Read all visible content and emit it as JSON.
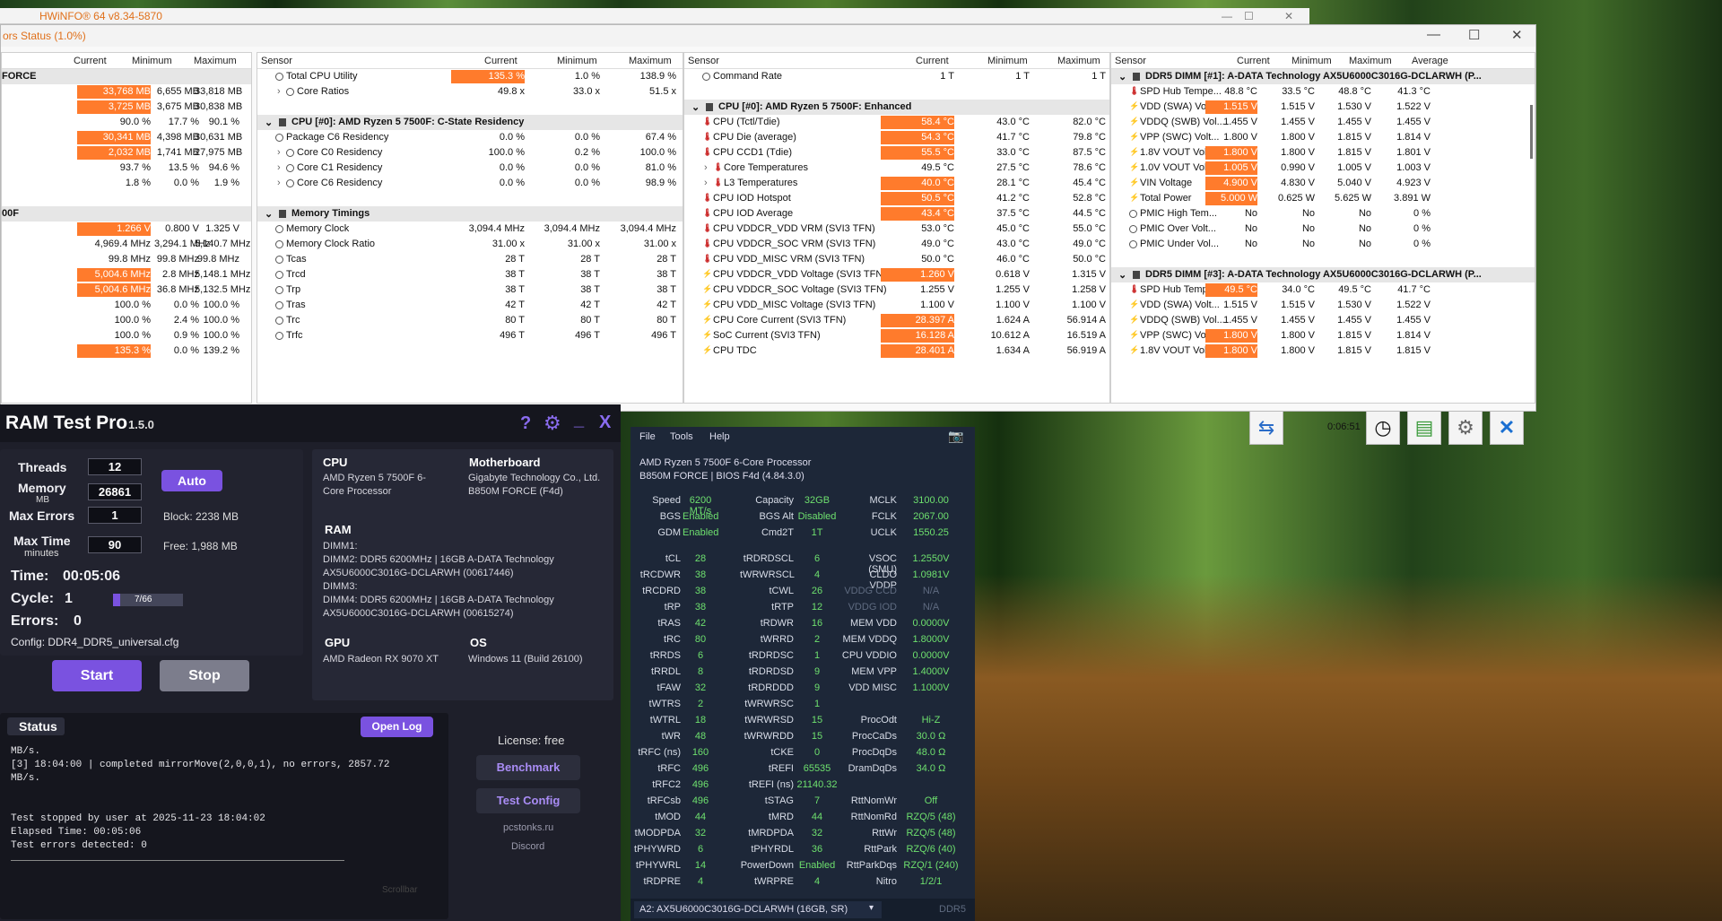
{
  "hwinfo": {
    "back_title": "HWiNFO® 64 v8.34-5870",
    "title": "ors Status (1.0%)",
    "timer": "0:06:51",
    "pane1": {
      "headers": [
        "Current",
        "Minimum",
        "Maximum"
      ],
      "rows": [
        {
          "g": true,
          "n": "FORCE"
        },
        {
          "c": "33,768 MB",
          "mn": "6,655 MB",
          "mx": "33,818 MB",
          "h": true
        },
        {
          "c": "3,725 MB",
          "mn": "3,675 MB",
          "mx": "30,838 MB",
          "h": true
        },
        {
          "c": "90.0 %",
          "mn": "17.7 %",
          "mx": "90.1 %"
        },
        {
          "c": "30,341 MB",
          "mn": "4,398 MB",
          "mx": "30,631 MB",
          "h": true
        },
        {
          "c": "2,032 MB",
          "mn": "1,741 MB",
          "mx": "27,975 MB",
          "h": true
        },
        {
          "c": "93.7 %",
          "mn": "13.5 %",
          "mx": "94.6 %"
        },
        {
          "c": "1.8 %",
          "mn": "0.0 %",
          "mx": "1.9 %"
        },
        {
          "n": ""
        },
        {
          "g": true,
          "n": "00F"
        },
        {
          "c": "1.266 V",
          "mn": "0.800 V",
          "mx": "1.325 V",
          "h": true
        },
        {
          "c": "4,969.4 MHz",
          "mn": "3,294.1 MHz",
          "mx": "5,140.7 MHz"
        },
        {
          "c": "99.8 MHz",
          "mn": "99.8 MHz",
          "mx": "99.8 MHz"
        },
        {
          "c": "5,004.6 MHz",
          "mn": "2.8 MHz",
          "mx": "5,148.1 MHz",
          "h": true
        },
        {
          "c": "5,004.6 MHz",
          "mn": "36.8 MHz",
          "mx": "5,132.5 MHz",
          "h": true
        },
        {
          "c": "100.0 %",
          "mn": "0.0 %",
          "mx": "100.0 %"
        },
        {
          "c": "100.0 %",
          "mn": "2.4 %",
          "mx": "100.0 %"
        },
        {
          "c": "100.0 %",
          "mn": "0.9 %",
          "mx": "100.0 %"
        },
        {
          "c": "135.3 %",
          "mn": "0.0 %",
          "mx": "139.2 %",
          "h": true
        }
      ]
    },
    "pane2": {
      "headers": [
        "Sensor",
        "Current",
        "Minimum",
        "Maximum"
      ],
      "rows": [
        {
          "n": "Total CPU Utility",
          "c": "135.3 %",
          "mn": "1.0 %",
          "mx": "138.9 %",
          "h": true,
          "i": "c"
        },
        {
          "n": "Core Ratios",
          "c": "49.8 x",
          "mn": "33.0 x",
          "mx": "51.5 x",
          "i": "c",
          "e": true
        },
        {
          "n": ""
        },
        {
          "g": true,
          "n": "CPU [#0]: AMD Ryzen 5 7500F: C-State Residency"
        },
        {
          "n": "Package C6 Residency",
          "c": "0.0 %",
          "mn": "0.0 %",
          "mx": "67.4 %",
          "i": "c"
        },
        {
          "n": "Core C0 Residency",
          "c": "100.0 %",
          "mn": "0.2 %",
          "mx": "100.0 %",
          "i": "c",
          "e": true
        },
        {
          "n": "Core C1 Residency",
          "c": "0.0 %",
          "mn": "0.0 %",
          "mx": "81.0 %",
          "i": "c",
          "e": true
        },
        {
          "n": "Core C6 Residency",
          "c": "0.0 %",
          "mn": "0.0 %",
          "mx": "98.9 %",
          "i": "c",
          "e": true
        },
        {
          "n": ""
        },
        {
          "g": true,
          "n": "Memory Timings"
        },
        {
          "n": "Memory Clock",
          "c": "3,094.4 MHz",
          "mn": "3,094.4 MHz",
          "mx": "3,094.4 MHz",
          "i": "c"
        },
        {
          "n": "Memory Clock Ratio",
          "c": "31.00 x",
          "mn": "31.00 x",
          "mx": "31.00 x",
          "i": "c"
        },
        {
          "n": "Tcas",
          "c": "28 T",
          "mn": "28 T",
          "mx": "28 T",
          "i": "c"
        },
        {
          "n": "Trcd",
          "c": "38 T",
          "mn": "38 T",
          "mx": "38 T",
          "i": "c"
        },
        {
          "n": "Trp",
          "c": "38 T",
          "mn": "38 T",
          "mx": "38 T",
          "i": "c"
        },
        {
          "n": "Tras",
          "c": "42 T",
          "mn": "42 T",
          "mx": "42 T",
          "i": "c"
        },
        {
          "n": "Trc",
          "c": "80 T",
          "mn": "80 T",
          "mx": "80 T",
          "i": "c"
        },
        {
          "n": "Trfc",
          "c": "496 T",
          "mn": "496 T",
          "mx": "496 T",
          "i": "c"
        }
      ]
    },
    "pane3": {
      "headers": [
        "Sensor",
        "Current",
        "Minimum",
        "Maximum"
      ],
      "rows": [
        {
          "n": "Command Rate",
          "c": "1 T",
          "mn": "1 T",
          "mx": "1 T",
          "i": "c"
        },
        {
          "n": ""
        },
        {
          "g": true,
          "n": "CPU [#0]: AMD Ryzen 5 7500F: Enhanced"
        },
        {
          "n": "CPU (Tctl/Tdie)",
          "c": "58.4 °C",
          "mn": "43.0 °C",
          "mx": "82.0 °C",
          "h": true,
          "i": "t"
        },
        {
          "n": "CPU Die (average)",
          "c": "54.3 °C",
          "mn": "41.7 °C",
          "mx": "79.8 °C",
          "h": true,
          "i": "t"
        },
        {
          "n": "CPU CCD1 (Tdie)",
          "c": "55.5 °C",
          "mn": "33.0 °C",
          "mx": "87.5 °C",
          "h": true,
          "i": "t"
        },
        {
          "n": "Core Temperatures",
          "c": "49.5 °C",
          "mn": "27.5 °C",
          "mx": "78.6 °C",
          "i": "t",
          "e": true
        },
        {
          "n": "L3 Temperatures",
          "c": "40.0 °C",
          "mn": "28.1 °C",
          "mx": "45.4 °C",
          "h": true,
          "i": "t",
          "e": true
        },
        {
          "n": "CPU IOD Hotspot",
          "c": "50.5 °C",
          "mn": "41.2 °C",
          "mx": "52.8 °C",
          "h": true,
          "i": "t"
        },
        {
          "n": "CPU IOD Average",
          "c": "43.4 °C",
          "mn": "37.5 °C",
          "mx": "44.5 °C",
          "h": true,
          "i": "t"
        },
        {
          "n": "CPU VDDCR_VDD VRM (SVI3 TFN)",
          "c": "53.0 °C",
          "mn": "45.0 °C",
          "mx": "55.0 °C",
          "i": "t"
        },
        {
          "n": "CPU VDDCR_SOC VRM (SVI3 TFN)",
          "c": "49.0 °C",
          "mn": "43.0 °C",
          "mx": "49.0 °C",
          "i": "t"
        },
        {
          "n": "CPU VDD_MISC VRM (SVI3 TFN)",
          "c": "50.0 °C",
          "mn": "46.0 °C",
          "mx": "50.0 °C",
          "i": "t"
        },
        {
          "n": "CPU VDDCR_VDD Voltage (SVI3 TFN)",
          "c": "1.260 V",
          "mn": "0.618 V",
          "mx": "1.315 V",
          "h": true,
          "i": "b"
        },
        {
          "n": "CPU VDDCR_SOC Voltage (SVI3 TFN)",
          "c": "1.255 V",
          "mn": "1.255 V",
          "mx": "1.258 V",
          "i": "b"
        },
        {
          "n": "CPU VDD_MISC Voltage (SVI3 TFN)",
          "c": "1.100 V",
          "mn": "1.100 V",
          "mx": "1.100 V",
          "i": "b"
        },
        {
          "n": "CPU Core Current (SVI3 TFN)",
          "c": "28.397 A",
          "mn": "1.624 A",
          "mx": "56.914 A",
          "h": true,
          "i": "b"
        },
        {
          "n": "SoC Current (SVI3 TFN)",
          "c": "16.128 A",
          "mn": "10.612 A",
          "mx": "16.519 A",
          "h": true,
          "i": "b"
        },
        {
          "n": "CPU TDC",
          "c": "28.401 A",
          "mn": "1.634 A",
          "mx": "56.919 A",
          "h": true,
          "i": "b"
        }
      ]
    },
    "pane4": {
      "headers": [
        "Sensor",
        "Current",
        "Minimum",
        "Maximum",
        "Average"
      ],
      "rows": [
        {
          "g": true,
          "n": "DDR5 DIMM [#1]: A-DATA Technology AX5U6000C3016G-DCLARWH (P..."
        },
        {
          "n": "SPD Hub Tempe...",
          "c": "48.8 °C",
          "mn": "33.5 °C",
          "mx": "48.8 °C",
          "a": "41.3 °C",
          "i": "t"
        },
        {
          "n": "VDD (SWA) Volt...",
          "c": "1.515 V",
          "mn": "1.515 V",
          "mx": "1.530 V",
          "a": "1.522 V",
          "h": true,
          "i": "b"
        },
        {
          "n": "VDDQ (SWB) Vol...",
          "c": "1.455 V",
          "mn": "1.455 V",
          "mx": "1.455 V",
          "a": "1.455 V",
          "i": "b"
        },
        {
          "n": "VPP (SWC) Volt...",
          "c": "1.800 V",
          "mn": "1.800 V",
          "mx": "1.815 V",
          "a": "1.814 V",
          "i": "b"
        },
        {
          "n": "1.8V VOUT Volt...",
          "c": "1.800 V",
          "mn": "1.800 V",
          "mx": "1.815 V",
          "a": "1.801 V",
          "h": true,
          "i": "b"
        },
        {
          "n": "1.0V VOUT Volt...",
          "c": "1.005 V",
          "mn": "0.990 V",
          "mx": "1.005 V",
          "a": "1.003 V",
          "h": true,
          "i": "b"
        },
        {
          "n": "VIN Voltage",
          "c": "4.900 V",
          "mn": "4.830 V",
          "mx": "5.040 V",
          "a": "4.923 V",
          "h": true,
          "i": "b"
        },
        {
          "n": "Total Power",
          "c": "5.000 W",
          "mn": "0.625 W",
          "mx": "5.625 W",
          "a": "3.891 W",
          "h": true,
          "i": "b"
        },
        {
          "n": "PMIC High Tem...",
          "c": "No",
          "mn": "No",
          "mx": "No",
          "a": "0 %",
          "i": "c"
        },
        {
          "n": "PMIC Over Volt...",
          "c": "No",
          "mn": "No",
          "mx": "No",
          "a": "0 %",
          "i": "c"
        },
        {
          "n": "PMIC Under Vol...",
          "c": "No",
          "mn": "No",
          "mx": "No",
          "a": "0 %",
          "i": "c"
        },
        {
          "n": ""
        },
        {
          "g": true,
          "n": "DDR5 DIMM [#3]: A-DATA Technology AX5U6000C3016G-DCLARWH (P..."
        },
        {
          "n": "SPD Hub Tempe...",
          "c": "49.5 °C",
          "mn": "34.0 °C",
          "mx": "49.5 °C",
          "a": "41.7 °C",
          "h": true,
          "i": "t"
        },
        {
          "n": "VDD (SWA) Volt...",
          "c": "1.515 V",
          "mn": "1.515 V",
          "mx": "1.530 V",
          "a": "1.522 V",
          "i": "b"
        },
        {
          "n": "VDDQ (SWB) Vol...",
          "c": "1.455 V",
          "mn": "1.455 V",
          "mx": "1.455 V",
          "a": "1.455 V",
          "i": "b"
        },
        {
          "n": "VPP (SWC) Volt...",
          "c": "1.800 V",
          "mn": "1.800 V",
          "mx": "1.815 V",
          "a": "1.814 V",
          "h": true,
          "i": "b"
        },
        {
          "n": "1.8V VOUT Volt...",
          "c": "1.800 V",
          "mn": "1.800 V",
          "mx": "1.815 V",
          "a": "1.815 V",
          "h": true,
          "i": "b"
        }
      ]
    }
  },
  "rtp": {
    "title": "RAM Test Pro",
    "version": "1.5.0",
    "threads_label": "Threads",
    "threads": "12",
    "memory_label": "Memory",
    "memory_unit": "MB",
    "memory": "26861",
    "maxerr_label": "Max Errors",
    "maxerr": "1",
    "maxtime_label": "Max Time",
    "maxtime_unit": "minutes",
    "maxtime": "90",
    "auto": "Auto",
    "block": "Block:   2238 MB",
    "free": "Free:   1,988 MB",
    "time_label": "Time:",
    "time": "00:05:06",
    "cycle_label": "Cycle:",
    "cycle": "1",
    "cycle_prog": "7/66",
    "cycle_fraction": 0.106,
    "errors_label": "Errors:",
    "errors": "0",
    "config": "Config: DDR4_DDR5_universal.cfg",
    "start": "Start",
    "stop": "Stop",
    "cpu_h": "CPU",
    "cpu": "AMD Ryzen 5 7500F 6-Core Processor",
    "mb_h": "Motherboard",
    "mb": "Gigabyte Technology Co., Ltd. B850M FORCE (F4d)",
    "ram_h": "RAM",
    "ram_lines": [
      "DIMM1:",
      "DIMM2: DDR5 6200MHz | 16GB A-DATA Technology",
      "AX5U6000C3016G-DCLARWH (00617446)",
      "DIMM3:",
      "DIMM4: DDR5 6200MHz | 16GB A-DATA Technology",
      "AX5U6000C3016G-DCLARWH (00615274)"
    ],
    "gpu_h": "GPU",
    "gpu": "AMD Radeon RX 9070 XT",
    "os_h": "OS",
    "os": "Windows 11 (Build 26100)",
    "status_h": "Status",
    "openlog": "Open Log",
    "log": [
      "MB/s.",
      "[3] 18:04:00 | completed mirrorMove(2,0,0,1), no errors, 2857.72",
      "MB/s.",
      "",
      "",
      "Test stopped by user at 2025-11-23 18:04:02",
      "Elapsed Time: 00:05:06",
      "Test errors detected: 0"
    ],
    "license": "License: free",
    "benchmark": "Benchmark",
    "testconfig": "Test Config",
    "site": "pcstonks.ru",
    "discord": "Discord",
    "scrollbar": "Scrollbar"
  },
  "zt": {
    "menu": [
      "File",
      "Tools",
      "Help"
    ],
    "cpu": "AMD Ryzen 5 7500F 6-Core Processor",
    "board": "B850M FORCE | BIOS F4d (4.84.3.0)",
    "top": [
      [
        "Speed",
        "6200 MT/s",
        "Capacity",
        "32GB",
        "MCLK",
        "3100.00"
      ],
      [
        "BGS",
        "Enabled",
        "BGS Alt",
        "Disabled",
        "FCLK",
        "2067.00"
      ],
      [
        "GDM",
        "Enabled",
        "Cmd2T",
        "1T",
        "UCLK",
        "1550.25"
      ]
    ],
    "rows": [
      [
        "tCL",
        "28",
        "tRDRDSCL",
        "6",
        "VSOC (SMU)",
        "1.2550V"
      ],
      [
        "tRCDWR",
        "38",
        "tWRWRSCL",
        "4",
        "CLDO VDDP",
        "1.0981V"
      ],
      [
        "tRCDRD",
        "38",
        "tCWL",
        "26",
        "VDDG CCD",
        "N/A"
      ],
      [
        "tRP",
        "38",
        "tRTP",
        "12",
        "VDDG IOD",
        "N/A"
      ],
      [
        "tRAS",
        "42",
        "tRDWR",
        "16",
        "MEM VDD",
        "0.0000V"
      ],
      [
        "tRC",
        "80",
        "tWRRD",
        "2",
        "MEM VDDQ",
        "1.8000V"
      ],
      [
        "tRRDS",
        "6",
        "tRDRDSC",
        "1",
        "CPU VDDIO",
        "0.0000V"
      ],
      [
        "tRRDL",
        "8",
        "tRDRDSD",
        "9",
        "MEM VPP",
        "1.4000V"
      ],
      [
        "tFAW",
        "32",
        "tRDRDDD",
        "9",
        "VDD MISC",
        "1.1000V"
      ],
      [
        "tWTRS",
        "2",
        "tWRWRSC",
        "1",
        "",
        ""
      ],
      [
        "tWTRL",
        "18",
        "tWRWRSD",
        "15",
        "ProcOdt",
        "Hi-Z"
      ],
      [
        "tWR",
        "48",
        "tWRWRDD",
        "15",
        "ProcCaDs",
        "30.0 Ω"
      ],
      [
        "tRFC (ns)",
        "160",
        "tCKE",
        "0",
        "ProcDqDs",
        "48.0 Ω"
      ],
      [
        "tRFC",
        "496",
        "tREFI",
        "65535",
        "DramDqDs",
        "34.0 Ω"
      ],
      [
        "tRFC2",
        "496",
        "tREFI (ns)",
        "21140.32",
        "",
        ""
      ],
      [
        "tRFCsb",
        "496",
        "tSTAG",
        "7",
        "RttNomWr",
        "Off"
      ],
      [
        "tMOD",
        "44",
        "tMRD",
        "44",
        "RttNomRd",
        "RZQ/5 (48)"
      ],
      [
        "tMODPDA",
        "32",
        "tMRDPDA",
        "32",
        "RttWr",
        "RZQ/5 (48)"
      ],
      [
        "tPHYWRD",
        "6",
        "tPHYRDL",
        "36",
        "RttPark",
        "RZQ/6 (40)"
      ],
      [
        "tPHYWRL",
        "14",
        "PowerDown",
        "Enabled",
        "RttParkDqs",
        "RZQ/1 (240)"
      ],
      [
        "tRDPRE",
        "4",
        "tWRPRE",
        "4",
        "Nitro",
        "1/2/1"
      ]
    ],
    "module": "A2: AX5U6000C3016G-DCLARWH (16GB, SR)",
    "ddr": "DDR5"
  }
}
